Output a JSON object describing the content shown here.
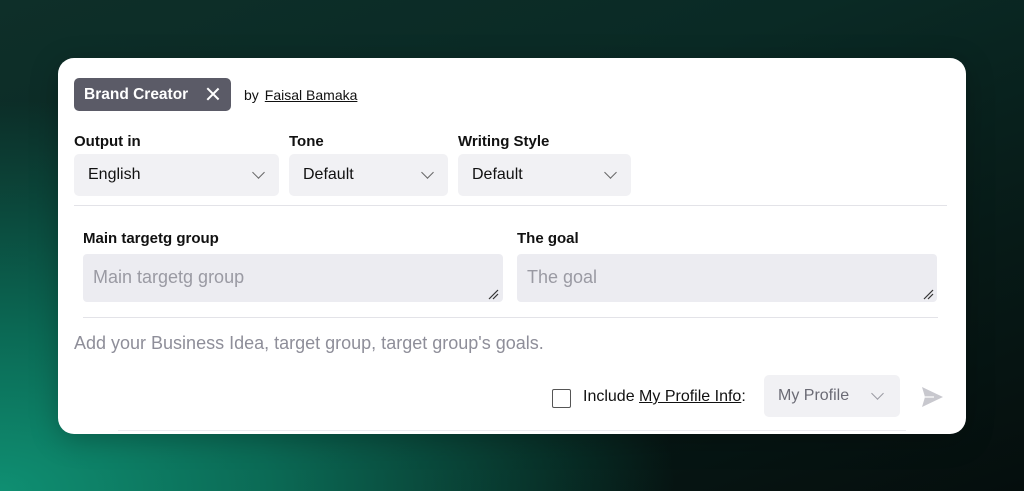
{
  "prompt": {
    "name": "Brand Creator",
    "by_label": "by",
    "author": "Faisal Bamaka"
  },
  "selectors": {
    "output": {
      "label": "Output in",
      "value": "English"
    },
    "tone": {
      "label": "Tone",
      "value": "Default"
    },
    "style": {
      "label": "Writing Style",
      "value": "Default"
    }
  },
  "fields": {
    "group": {
      "label": "Main targetg group",
      "placeholder": "Main targetg group"
    },
    "goal": {
      "label": "The goal",
      "placeholder": "The goal"
    }
  },
  "hint": "Add your Business Idea, target group, target group's goals.",
  "footer": {
    "include_prefix": "Include ",
    "include_link": "My Profile Info",
    "include_suffix": ":",
    "profile_value": "My Profile"
  },
  "icons": {
    "close": "close-icon",
    "chevron": "chevron-down-icon",
    "resize": "resize-grip-icon",
    "send": "send-icon"
  },
  "colors": {
    "chip_bg": "#5b5b67",
    "field_bg": "#ececf1",
    "select_bg": "#f1f1f4",
    "hint_text": "#8e8e99"
  }
}
